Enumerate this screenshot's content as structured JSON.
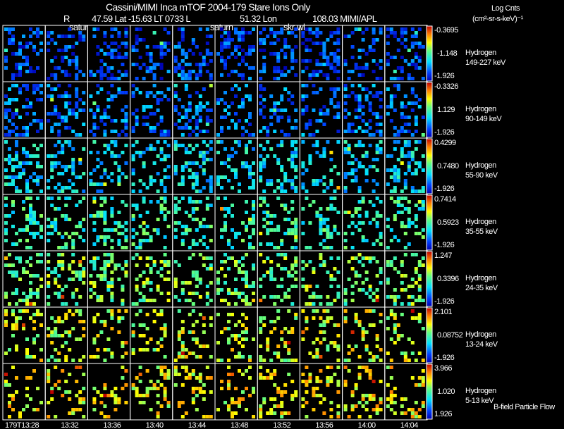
{
  "header": {
    "title": "Cassini/MIMI Inca mTOF  2004-179   Stare   Ions Only",
    "r_label": "R",
    "ephemeris": "47.59 Lat -15.63 LT 0733 L",
    "lon": "51.32 Lon",
    "value2": "108.03  MIMI/APL",
    "units_line1": "Log Cnts",
    "units_line2": "(cm²-sr-s-keV)⁻¹",
    "markers": [
      "satur",
      "saturn",
      "skr-wl"
    ]
  },
  "footer_note": "B-field Particle Flow",
  "chart_data": {
    "type": "heatmap",
    "title": "Cassini/MIMI Inca mTOF  2004-179   Stare   Ions Only",
    "x_tick_labels": [
      "179T13:28",
      "13:32",
      "13:36",
      "13:40",
      "13:44",
      "13:48",
      "13:52",
      "13:56",
      "14:00",
      "14:04"
    ],
    "colormap": "rainbow (blue-cyan-green-yellow-red)",
    "rows": [
      {
        "species": "Hydrogen",
        "energy": "149-227 keV",
        "cbar_max": "-0.3695",
        "cbar_mid": "-1.148",
        "cbar_min": "-1.926",
        "level": 0.15
      },
      {
        "species": "Hydrogen",
        "energy": "90-149 keV",
        "cbar_max": "-0.3326",
        "cbar_mid": "1.129",
        "cbar_min": "-1.926",
        "level": 0.2
      },
      {
        "species": "Hydrogen",
        "energy": "55-90 keV",
        "cbar_max": "0.4299",
        "cbar_mid": "0.7480",
        "cbar_min": "-1.926",
        "level": 0.35
      },
      {
        "species": "Hydrogen",
        "energy": "35-55 keV",
        "cbar_max": "0.7414",
        "cbar_mid": "0.5923",
        "cbar_min": "-1.926",
        "level": 0.45
      },
      {
        "species": "Hydrogen",
        "energy": "24-35 keV",
        "cbar_max": "1.247",
        "cbar_mid": "0.3396",
        "cbar_min": "-1.926",
        "level": 0.55
      },
      {
        "species": "Hydrogen",
        "energy": "13-24 keV",
        "cbar_max": "2.101",
        "cbar_mid": "0.08752",
        "cbar_min": "-1.926",
        "level": 0.65
      },
      {
        "species": "Hydrogen",
        "energy": "5-13 keV",
        "cbar_max": "3.966",
        "cbar_mid": "1.020",
        "cbar_min": "1.926",
        "level": 0.7
      }
    ]
  }
}
